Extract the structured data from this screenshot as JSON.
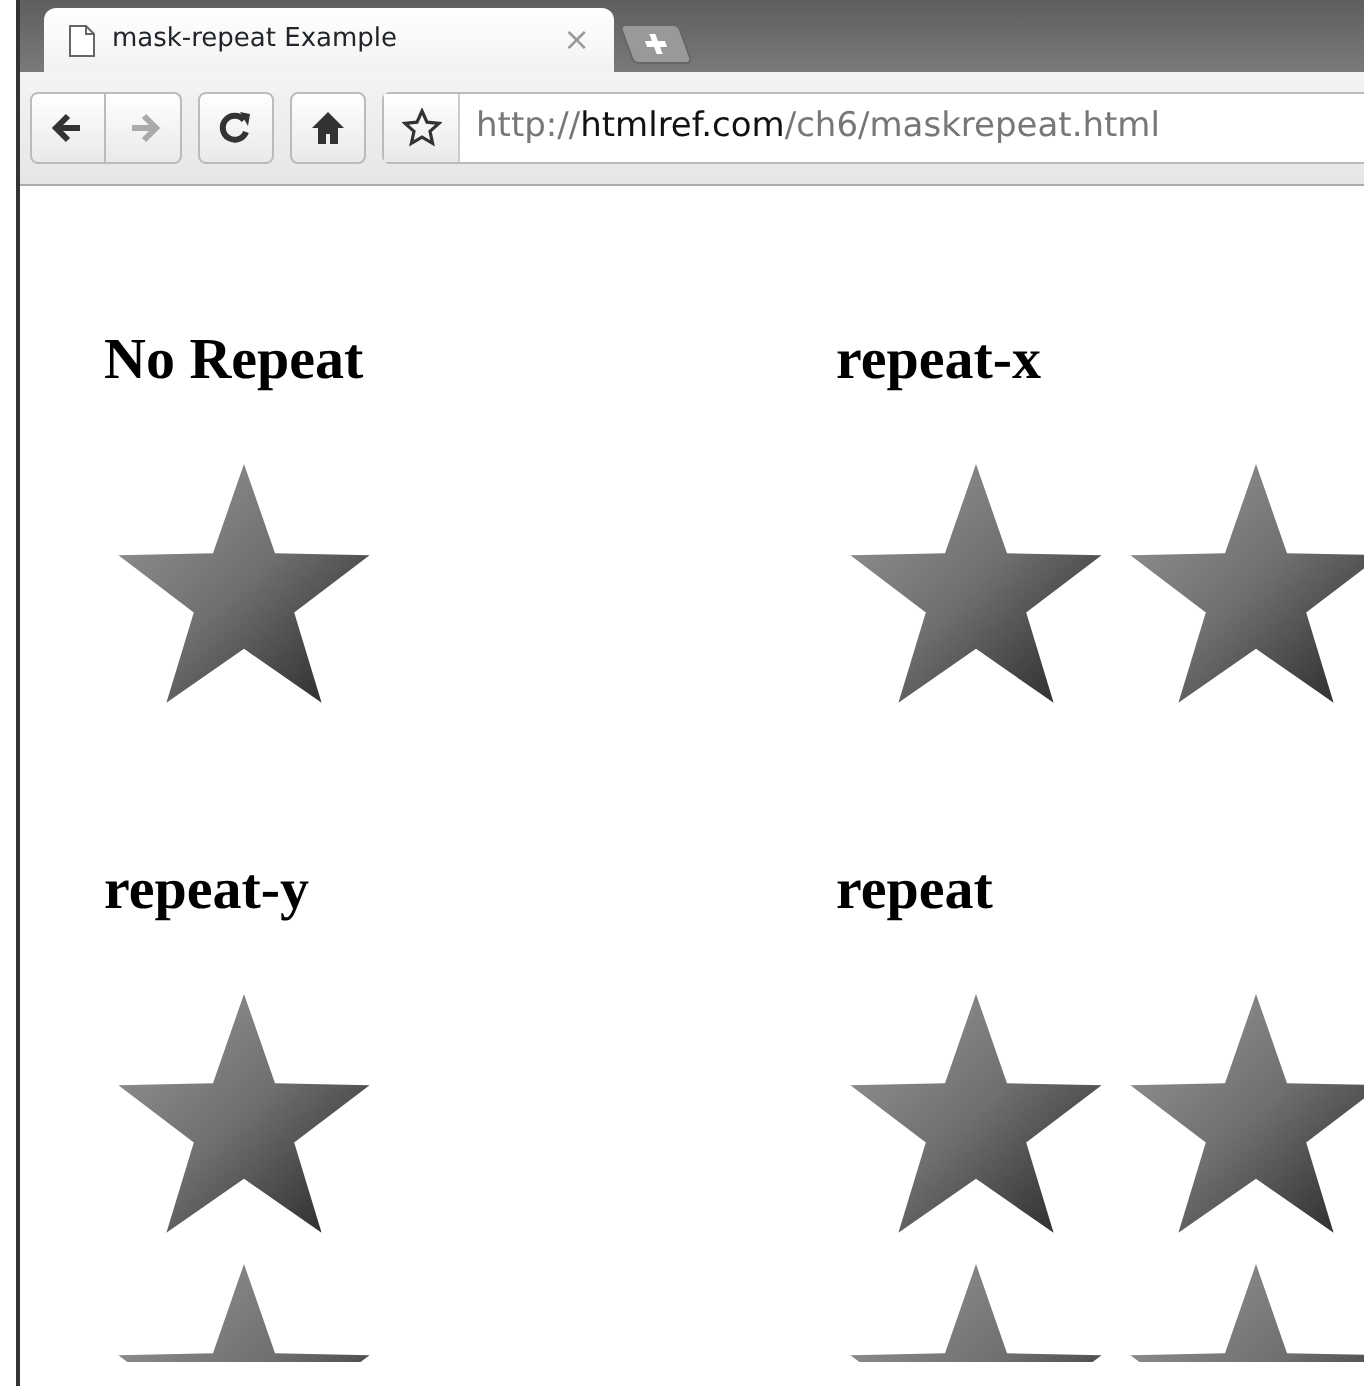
{
  "tab": {
    "title": "mask-repeat Example",
    "close": "×",
    "selected": true
  },
  "toolbar": {
    "buttons": [
      {
        "kind": "back",
        "disabled": false
      },
      {
        "kind": "forward",
        "disabled": true
      },
      {
        "kind": "reload",
        "disabled": false
      },
      {
        "kind": "home",
        "disabled": false
      }
    ],
    "url": {
      "scheme": "http://",
      "host": "htmlref.com",
      "path": "/ch6/maskrepeat.html"
    }
  },
  "sections": [
    {
      "heading": "No Repeat",
      "kind": "single"
    },
    {
      "heading": "repeat-x",
      "kind": "row"
    },
    {
      "heading": "repeat-y",
      "kind": "column"
    },
    {
      "heading": "repeat",
      "kind": "grid"
    }
  ]
}
